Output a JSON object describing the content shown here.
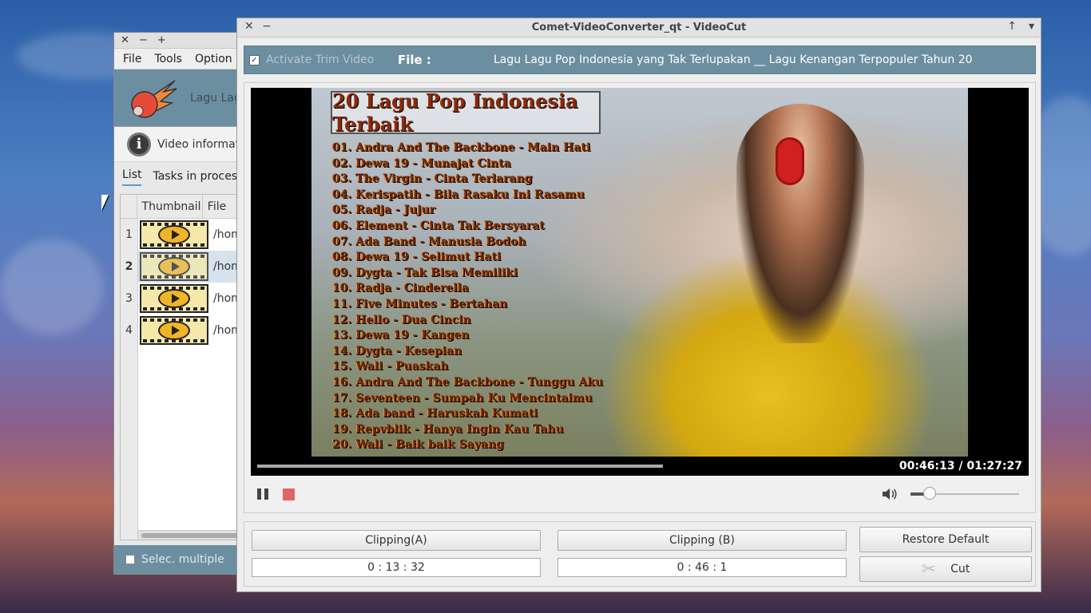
{
  "main_window": {
    "titlebar": {
      "close": "✕",
      "minimize": "−",
      "maximize": "+"
    },
    "menu": [
      "File",
      "Tools",
      "Option"
    ],
    "banner_text": "Lagu Lag",
    "info_label": "Video informat",
    "tabs": [
      "List",
      "Tasks in proces"
    ],
    "table": {
      "headers": [
        "Thumbnail",
        "File"
      ],
      "rows": [
        {
          "num": "1",
          "path": "/hom"
        },
        {
          "num": "2",
          "path": "/hom"
        },
        {
          "num": "3",
          "path": "/hom"
        },
        {
          "num": "4",
          "path": "/hom"
        }
      ]
    },
    "select_multiple": "Selec. multiple"
  },
  "cut_window": {
    "title": "Comet-VideoConverter_qt - VideoCut",
    "titlebar": {
      "close": "✕",
      "minimize": "−",
      "up": "↑",
      "down": "▾"
    },
    "activate_trim_label": "Activate Trim Video",
    "file_label": "File :",
    "file_name": "Lagu Lagu Pop Indonesia yang Tak Terlupakan __ Lagu Kenangan Terpopuler Tahun 20",
    "video": {
      "poster_title": "20 Lagu Pop Indonesia Terbaik",
      "songs": [
        "01. Andra And The Backbone - Main Hati",
        "02. Dewa 19 - Munajat Cinta",
        "03. The Virgin - Cinta Terlarang",
        "04. Kerispatih - Bila Rasaku Ini Rasamu",
        "05. Radja - Jujur",
        "06. Element - Cinta Tak Bersyarat",
        "07. Ada Band - Manusia Bodoh",
        "08. Dewa 19 - Selimut Hati",
        "09. Dygta - Tak Bisa Memiliki",
        "10. Radja - Cinderella",
        "11. Five Minutes - Bertahan",
        "12. Hello - Dua Cincin",
        "13. Dewa 19 - Kangen",
        "14. Dygta - Kesepian",
        "15. Wali - Puaskah",
        "16. Andra And The Backbone - Tunggu Aku",
        "17. Seventeen - Sumpah Ku Mencintaimu",
        "18. Ada band - Haruskah Kumati",
        "19. Repvblik - Hanya Ingin Kau Tahu",
        "20. Wali - Baik baik Sayang"
      ],
      "timecode": "00:46:13 / 01:27:27",
      "progress_fraction": 0.53,
      "volume_fraction": 0.18
    },
    "clipping_a_label": "Clipping(A)",
    "clipping_a_value": "0 : 13 : 32",
    "clipping_b_label": "Clipping (B)",
    "clipping_b_value": "0 : 46 : 1",
    "restore_label": "Restore Default",
    "cut_label": "Cut"
  }
}
